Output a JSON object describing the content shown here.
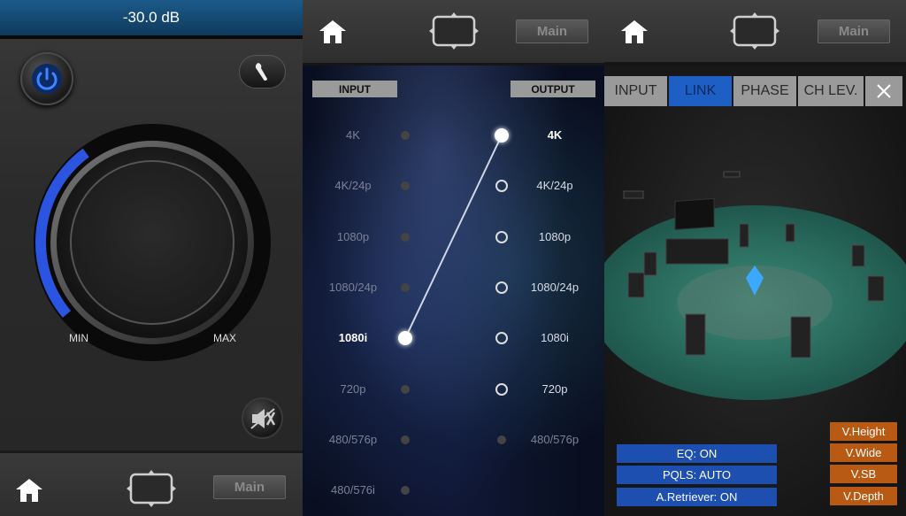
{
  "volume_panel": {
    "volume_readout": "-30.0 dB",
    "volume_level": 0.36,
    "knob_min_label": "MIN",
    "knob_max_label": "MAX",
    "main_label": "Main"
  },
  "resolution_panel": {
    "input_header": "INPUT",
    "output_header": "OUTPUT",
    "main_label": "Main",
    "inputs": [
      "4K",
      "4K/24p",
      "1080p",
      "1080/24p",
      "1080i",
      "720p",
      "480/576p",
      "480/576i"
    ],
    "outputs": [
      "4K",
      "4K/24p",
      "1080p",
      "1080/24p",
      "1080i",
      "720p",
      "480/576p"
    ],
    "selected_input": "1080i",
    "selected_output": "4K"
  },
  "speaker_panel": {
    "main_label": "Main",
    "tabs": [
      {
        "label": "INPUT",
        "active": false
      },
      {
        "label": "LINK",
        "active": true
      },
      {
        "label": "PHASE",
        "active": false
      },
      {
        "label": "CH LEV.",
        "active": false
      }
    ],
    "status_buttons": [
      "EQ: ON",
      "PQLS: AUTO",
      "A.Retriever: ON"
    ],
    "virtual_buttons": [
      "V.Height",
      "V.Wide",
      "V.SB",
      "V.Depth"
    ]
  },
  "colors": {
    "accent_blue": "#1d5fc4",
    "virtual_orange": "#b85a14",
    "readout_bar": "#1c5a8a"
  },
  "icons": [
    "power-icon",
    "wrench-icon",
    "mute-icon",
    "home-icon",
    "screen-icon",
    "close-icon"
  ]
}
